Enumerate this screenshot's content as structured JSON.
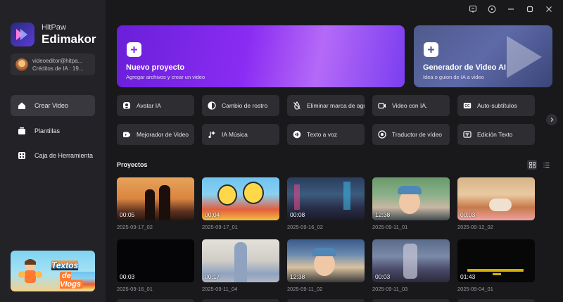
{
  "app": {
    "brand_line1": "HitPaw",
    "brand_line2": "Edimakor"
  },
  "user": {
    "email": "videoeditor@hitpa...",
    "credits": "Créditos de IA : 19..."
  },
  "sidebar": {
    "items": [
      {
        "label": "Crear Video",
        "icon": "home-icon",
        "active": true
      },
      {
        "label": "Plantillas",
        "icon": "templates-icon",
        "active": false
      },
      {
        "label": "Caja de Herramienta",
        "icon": "toolbox-icon",
        "active": false
      }
    ],
    "promo": {
      "line1": "Textos",
      "line2": "de Vlogs"
    }
  },
  "hero": {
    "new_project": {
      "title": "Nuevo proyecto",
      "subtitle": "Agregar archivos y crear un video"
    },
    "ai_generator": {
      "title": "Generador de Video AI",
      "subtitle": "Idea o guion de IA a video"
    }
  },
  "tools": [
    {
      "label": "Avatar IA",
      "icon": "avatar-icon"
    },
    {
      "label": "Cambio de rostro",
      "icon": "face-swap-icon"
    },
    {
      "label": "Eliminar marca de agua",
      "icon": "watermark-remove-icon"
    },
    {
      "label": "Video con IA.",
      "icon": "ai-video-icon"
    },
    {
      "label": "Auto-subtítulos",
      "icon": "subtitles-icon"
    },
    {
      "label": "Mejorador de Video",
      "icon": "enhancer-icon"
    },
    {
      "label": "IA Música",
      "icon": "music-icon"
    },
    {
      "label": "Texto a voz",
      "icon": "tts-icon"
    },
    {
      "label": "Traductor de vídeo",
      "icon": "translate-icon"
    },
    {
      "label": "Edición Texto",
      "icon": "text-edit-icon"
    }
  ],
  "projects_section": {
    "title": "Proyectos"
  },
  "projects": [
    {
      "duration": "00:05",
      "name": "2025-09-17_02"
    },
    {
      "duration": "00:04",
      "name": "2025-09-17_01"
    },
    {
      "duration": "00:08",
      "name": "2025-09-16_02"
    },
    {
      "duration": "12:38",
      "name": "2025-09-11_01"
    },
    {
      "duration": "00:03",
      "name": "2025-09-12_02"
    },
    {
      "duration": "00:03",
      "name": "2025-09-16_01"
    },
    {
      "duration": "00:17",
      "name": "2025-09-11_04"
    },
    {
      "duration": "12:38",
      "name": "2025-09-11_02"
    },
    {
      "duration": "00:03",
      "name": "2025-09-11_03"
    },
    {
      "duration": "01:43",
      "name": "2025-09-04_01"
    }
  ],
  "colors": {
    "accent": "#8a2cf3",
    "background": "#19191c",
    "sidebar": "#232327"
  }
}
